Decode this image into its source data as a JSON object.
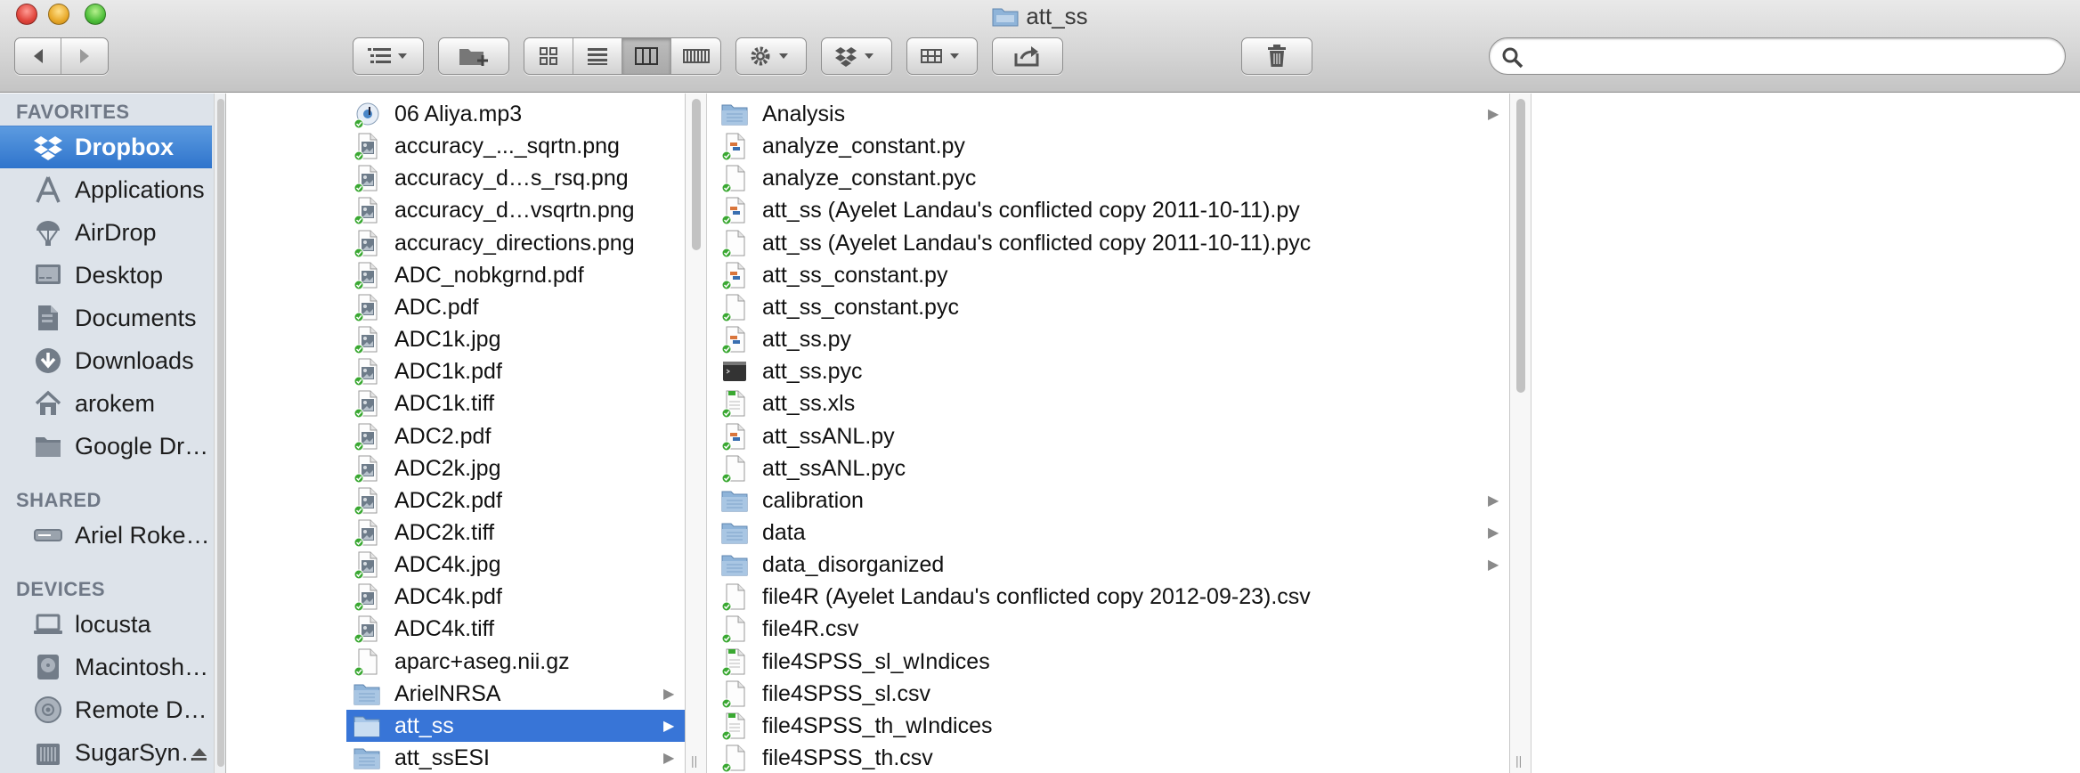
{
  "window": {
    "title": "att_ss"
  },
  "toolbar": {
    "search_placeholder": ""
  },
  "sidebar": {
    "sections": [
      {
        "header": "FAVORITES",
        "items": [
          {
            "label": "Dropbox",
            "icon": "dropbox-icon",
            "selected": true
          },
          {
            "label": "Applications",
            "icon": "applications-icon"
          },
          {
            "label": "AirDrop",
            "icon": "airdrop-icon"
          },
          {
            "label": "Desktop",
            "icon": "desktop-icon"
          },
          {
            "label": "Documents",
            "icon": "documents-icon"
          },
          {
            "label": "Downloads",
            "icon": "downloads-icon"
          },
          {
            "label": "arokem",
            "icon": "home-icon"
          },
          {
            "label": "Google Drive",
            "icon": "folder-icon"
          }
        ]
      },
      {
        "header": "SHARED",
        "items": [
          {
            "label": "Ariel Rokem's Tim…",
            "icon": "server-icon"
          }
        ]
      },
      {
        "header": "DEVICES",
        "items": [
          {
            "label": "locusta",
            "icon": "laptop-icon"
          },
          {
            "label": "Macintosh HD",
            "icon": "harddisk-icon"
          },
          {
            "label": "Remote Disc",
            "icon": "disc-icon"
          },
          {
            "label": "SugarSync Drive",
            "icon": "drive-icon",
            "eject": true
          }
        ]
      }
    ]
  },
  "column1": {
    "items": [
      {
        "name": "06 Aliya.mp3",
        "type": "audio"
      },
      {
        "name": "accuracy_..._sqrtn.png",
        "type": "image"
      },
      {
        "name": "accuracy_d…s_rsq.png",
        "type": "image"
      },
      {
        "name": "accuracy_d…vsqrtn.png",
        "type": "image"
      },
      {
        "name": "accuracy_directions.png",
        "type": "image"
      },
      {
        "name": "ADC_nobkgrnd.pdf",
        "type": "image"
      },
      {
        "name": "ADC.pdf",
        "type": "image"
      },
      {
        "name": "ADC1k.jpg",
        "type": "image"
      },
      {
        "name": "ADC1k.pdf",
        "type": "image"
      },
      {
        "name": "ADC1k.tiff",
        "type": "image"
      },
      {
        "name": "ADC2.pdf",
        "type": "image"
      },
      {
        "name": "ADC2k.jpg",
        "type": "image"
      },
      {
        "name": "ADC2k.pdf",
        "type": "image"
      },
      {
        "name": "ADC2k.tiff",
        "type": "image"
      },
      {
        "name": "ADC4k.jpg",
        "type": "image"
      },
      {
        "name": "ADC4k.pdf",
        "type": "image"
      },
      {
        "name": "ADC4k.tiff",
        "type": "image"
      },
      {
        "name": "aparc+aseg.nii.gz",
        "type": "doc"
      },
      {
        "name": "ArielNRSA",
        "type": "folder",
        "arrow": true
      },
      {
        "name": "att_ss",
        "type": "folder",
        "arrow": true,
        "selected": true
      },
      {
        "name": "att_ssESI",
        "type": "folder",
        "arrow": true
      }
    ]
  },
  "column2": {
    "items": [
      {
        "name": "Analysis",
        "type": "folder",
        "arrow": true
      },
      {
        "name": "analyze_constant.py",
        "type": "py"
      },
      {
        "name": "analyze_constant.pyc",
        "type": "doc"
      },
      {
        "name": "att_ss (Ayelet Landau's conflicted copy 2011-10-11).py",
        "type": "py"
      },
      {
        "name": "att_ss (Ayelet Landau's conflicted copy 2011-10-11).pyc",
        "type": "doc"
      },
      {
        "name": "att_ss_constant.py",
        "type": "py"
      },
      {
        "name": "att_ss_constant.pyc",
        "type": "doc"
      },
      {
        "name": "att_ss.py",
        "type": "py"
      },
      {
        "name": "att_ss.pyc",
        "type": "exec"
      },
      {
        "name": "att_ss.xls",
        "type": "xls"
      },
      {
        "name": "att_ssANL.py",
        "type": "py"
      },
      {
        "name": "att_ssANL.pyc",
        "type": "doc"
      },
      {
        "name": "calibration",
        "type": "folder",
        "arrow": true
      },
      {
        "name": "data",
        "type": "folder",
        "arrow": true
      },
      {
        "name": "data_disorganized",
        "type": "folder",
        "arrow": true
      },
      {
        "name": "file4R (Ayelet Landau's conflicted copy 2012-09-23).csv",
        "type": "doc"
      },
      {
        "name": "file4R.csv",
        "type": "doc"
      },
      {
        "name": "file4SPSS_sl_wIndices",
        "type": "xls"
      },
      {
        "name": "file4SPSS_sl.csv",
        "type": "doc"
      },
      {
        "name": "file4SPSS_th_wIndices",
        "type": "xls"
      },
      {
        "name": "file4SPSS_th.csv",
        "type": "doc"
      }
    ]
  },
  "colors": {
    "selection": "#3875d7",
    "sidebar_bg": "#dde3ea",
    "folder": "#8fb4d9",
    "sync_badge": "#3aa832"
  }
}
